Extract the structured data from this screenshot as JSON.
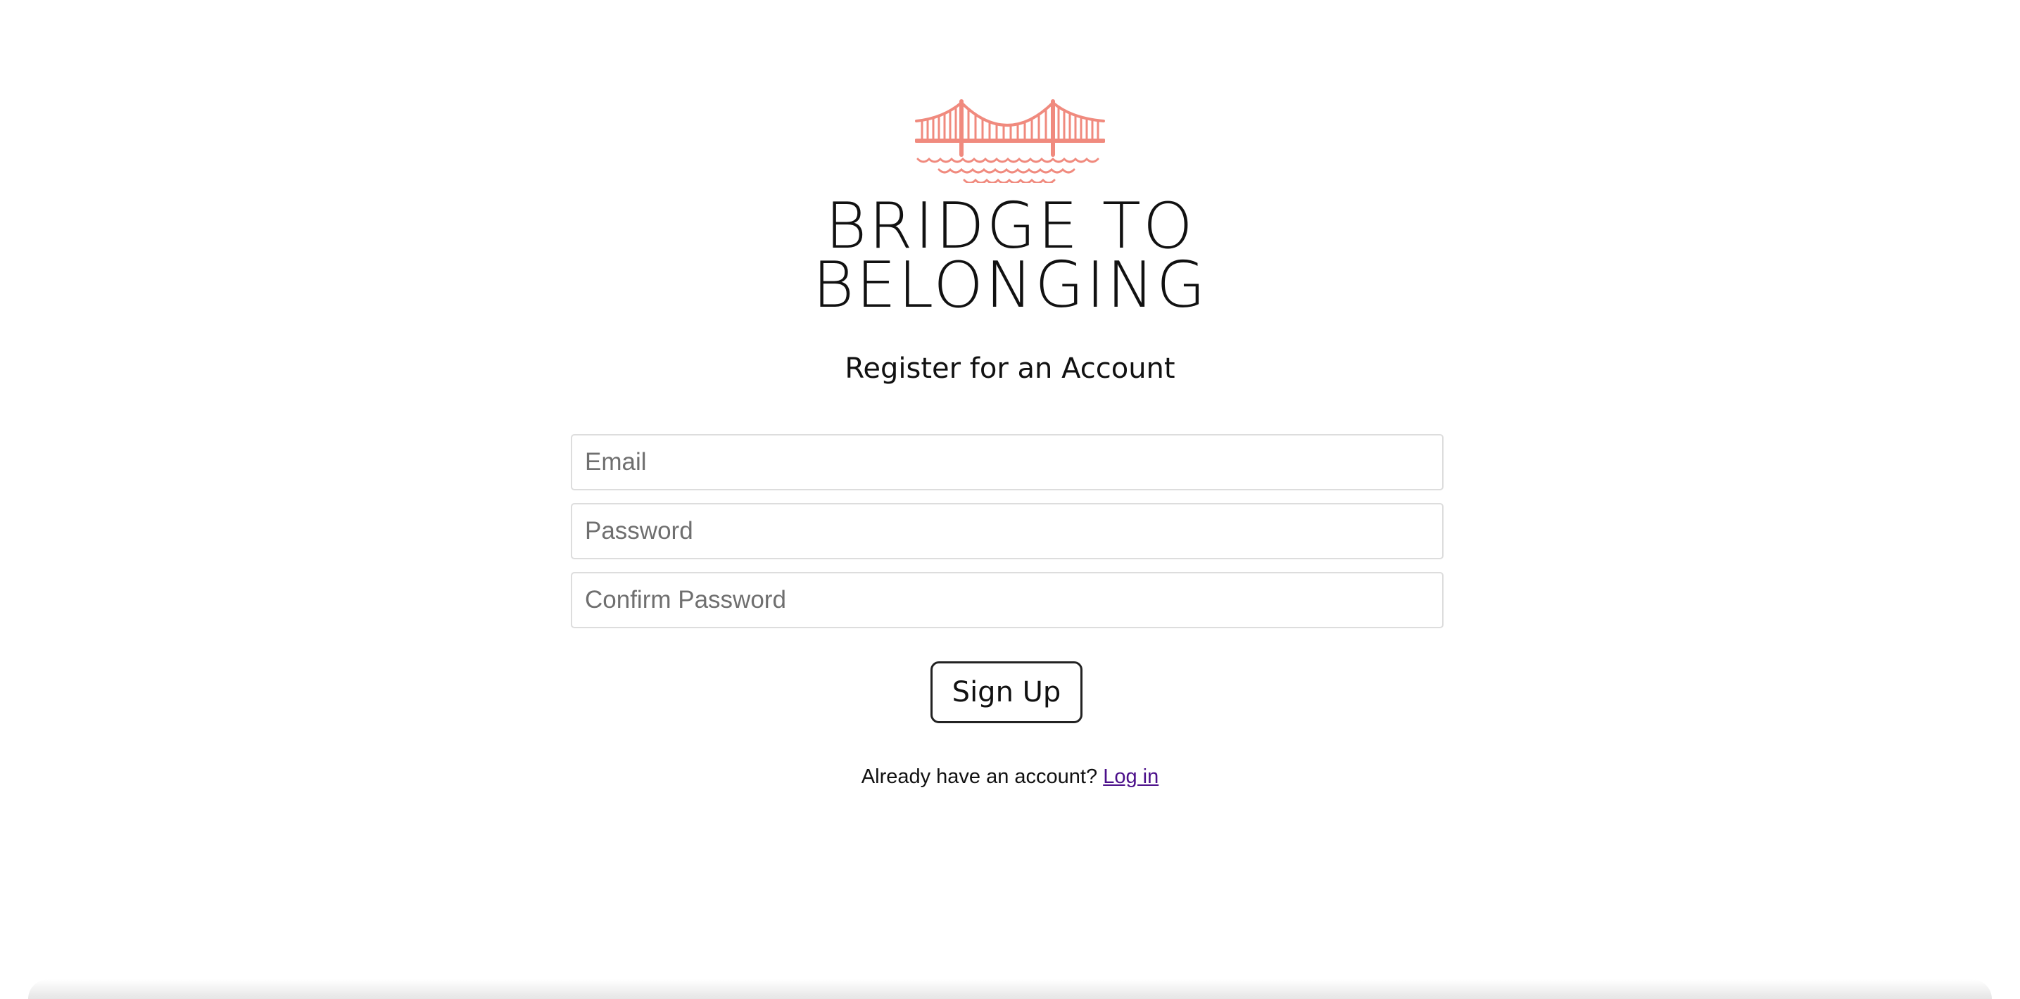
{
  "brand": {
    "line1": "BRIDGE TO",
    "line2": "BELONGING",
    "logo_icon": "bridge-icon",
    "accent_color": "#F08A7E"
  },
  "page": {
    "heading": "Register for an Account"
  },
  "form": {
    "email_placeholder": "Email",
    "password_placeholder": "Password",
    "confirm_placeholder": "Confirm Password",
    "submit_label": "Sign Up"
  },
  "footer": {
    "prompt": "Already have an account? ",
    "login_label": "Log in"
  }
}
